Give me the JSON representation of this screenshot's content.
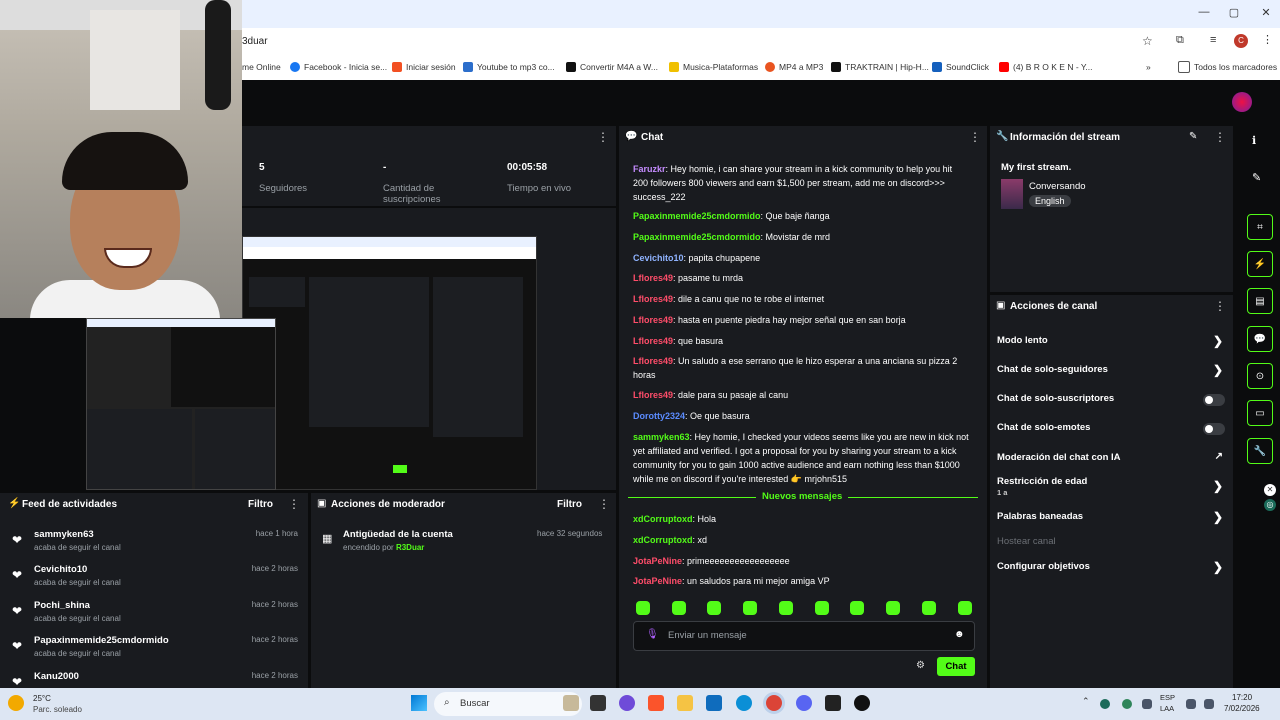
{
  "browser": {
    "url": "3duar",
    "window_controls": [
      "—",
      "▢",
      "✕"
    ],
    "bookmarks": [
      {
        "label": "me Online",
        "color": ""
      },
      {
        "label": "Facebook - Inicia se...",
        "color": "#1877f2"
      },
      {
        "label": "Iniciar sesión",
        "color": "#f25022"
      },
      {
        "label": "Youtube to mp3 co...",
        "color": "#2c6ecb"
      },
      {
        "label": "Convertir M4A a W...",
        "color": "#111111"
      },
      {
        "label": "Musica-Plataformas",
        "color": "#f0c000"
      },
      {
        "label": "MP4 a MP3",
        "color": "#e95420"
      },
      {
        "label": "TRAKTRAIN | Hip-H...",
        "color": "#111111"
      },
      {
        "label": "SoundClick",
        "color": "#1560bd"
      },
      {
        "label": "(4) B R O K E N - Y...",
        "color": "#ff0000"
      },
      {
        "label": "Todos los marcadores",
        "color": ""
      }
    ],
    "profile_initial": "C"
  },
  "stats": {
    "followers_value": "5",
    "followers_label": "Seguidores",
    "subs_value": "-",
    "subs_label": "Cantidad de suscripciones",
    "live_value": "00:05:58",
    "live_label": "Tiempo en vivo"
  },
  "activity_feed": {
    "title": "Feed de actividades",
    "filter": "Filtro",
    "items": [
      {
        "name": "sammyken63",
        "action": "acaba de seguir el canal",
        "time": "hace 1 hora"
      },
      {
        "name": "Cevichito10",
        "action": "acaba de seguir el canal",
        "time": "hace 2 horas"
      },
      {
        "name": "Pochi_shina",
        "action": "acaba de seguir el canal",
        "time": "hace 2 horas"
      },
      {
        "name": "Papaxinmemide25cmdormido",
        "action": "acaba de seguir el canal",
        "time": "hace 2 horas"
      },
      {
        "name": "Kanu2000",
        "action": "",
        "time": "hace 2 horas"
      }
    ]
  },
  "moderator": {
    "title": "Acciones de moderador",
    "filter": "Filtro",
    "item_title": "Antigüedad de la cuenta",
    "item_sub_prefix": "encendido por",
    "item_sub_user": "R3Duar",
    "item_time": "hace 32 segundos"
  },
  "chat": {
    "title": "Chat",
    "messages": [
      {
        "user": "Faruzkr",
        "color": "#c58cff",
        "text": ": Hey homie, i can share your stream in a kick community to help you hit 200 followers 800 viewers and earn $1,500 per stream, add me on discord>>> success_222"
      },
      {
        "user": "Papaxinmemide25cmdormido",
        "color": "#53fc18",
        "text": ": Que baje ñanga"
      },
      {
        "user": "Papaxinmemide25cmdormido",
        "color": "#53fc18",
        "text": ": Movistar de mrd"
      },
      {
        "user": "Cevichito10",
        "color": "#8fb3ff",
        "text": ": papita chupapene"
      },
      {
        "user": "Lflores49",
        "color": "#ff4d6a",
        "text": ": pasame tu mrda"
      },
      {
        "user": "Lflores49",
        "color": "#ff4d6a",
        "text": ": dile a canu que no te robe el internet"
      },
      {
        "user": "Lflores49",
        "color": "#ff4d6a",
        "text": ": hasta en puente piedra hay mejor señal que en san borja"
      },
      {
        "user": "Lflores49",
        "color": "#ff4d6a",
        "text": ": que basura"
      },
      {
        "user": "Lflores49",
        "color": "#ff4d6a",
        "text": ": Un saludo a ese serrano que le hizo esperar a una anciana su pizza 2 horas"
      },
      {
        "user": "Lflores49",
        "color": "#ff4d6a",
        "text": ": dale para su pasaje al canu"
      },
      {
        "user": "Dorotty2324",
        "color": "#5b8cff",
        "text": ": Oe que basura"
      },
      {
        "user": "sammyken63",
        "color": "#53fc18",
        "text": ": Hey homie, I checked your videos seems like you are new in kick not yet affiliated and verified. I got a proposal for you by sharing your stream to a kick community for you to gain 1000 active audience and earn nothing less than $1000 while me on discord if you're interested 👉 mrjohn515"
      }
    ],
    "new_messages_label": "Nuevos mensajes",
    "new_messages": [
      {
        "user": "xdCorruptoxd",
        "color": "#53fc18",
        "text": ": Hola"
      },
      {
        "user": "xdCorruptoxd",
        "color": "#53fc18",
        "text": ": xd"
      },
      {
        "user": "JotaPeNine",
        "color": "#ff4d6a",
        "text": ": primeeeeeeeeeeeeeeeee"
      },
      {
        "user": "JotaPeNine",
        "color": "#ff4d6a",
        "text": ": un saludos para mi mejor amiga VP"
      }
    ],
    "input_placeholder": "Enviar un mensaje",
    "send_label": "Chat"
  },
  "stream_info": {
    "title": "Información del stream",
    "stream_title": "My first stream.",
    "category": "Conversando",
    "language": "English"
  },
  "channel_actions": {
    "title": "Acciones de canal",
    "items": [
      {
        "label": "Modo lento",
        "control": "chevron"
      },
      {
        "label": "Chat de solo-seguidores",
        "control": "chevron"
      },
      {
        "label": "Chat de solo-suscriptores",
        "control": "toggle"
      },
      {
        "label": "Chat de solo-emotes",
        "control": "toggle"
      },
      {
        "label": "Moderación del chat con IA",
        "control": "external"
      },
      {
        "label": "Restricción de edad",
        "sub": "1 a",
        "control": "chevron"
      },
      {
        "label": "Palabras baneadas",
        "control": "chevron"
      },
      {
        "label": "Hostear canal",
        "control": "none",
        "disabled": true
      },
      {
        "label": "Configurar objetivos",
        "control": "chevron"
      }
    ]
  },
  "taskbar": {
    "temp": "25°C",
    "weather": "Parc. soleado",
    "search": "Buscar",
    "lang": "ESP",
    "lang2": "LAA",
    "time": "17:20",
    "date": "7/02/2026"
  }
}
